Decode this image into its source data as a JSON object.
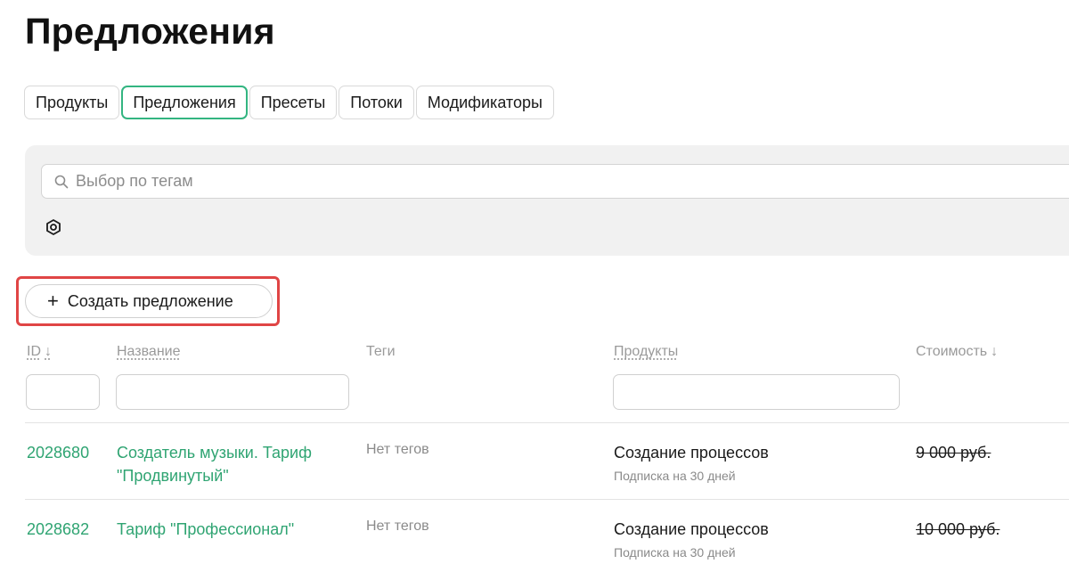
{
  "page": {
    "title": "Предложения"
  },
  "tabs": [
    {
      "label": "Продукты",
      "active": false
    },
    {
      "label": "Предложения",
      "active": true
    },
    {
      "label": "Пресеты",
      "active": false
    },
    {
      "label": "Потоки",
      "active": false
    },
    {
      "label": "Модификаторы",
      "active": false
    }
  ],
  "filters": {
    "tag_search_placeholder": "Выбор по тегам",
    "settings_icon": "hexagon-settings-icon"
  },
  "actions": {
    "create_label": "Создать предложение",
    "create_icon": "+"
  },
  "table": {
    "columns": [
      {
        "label": "ID",
        "sort": "↓"
      },
      {
        "label": "Название"
      },
      {
        "label": "Теги"
      },
      {
        "label": "Продукты"
      },
      {
        "label": "Стоимость",
        "sort": "↓"
      }
    ],
    "rows": [
      {
        "id": "2028680",
        "name": "Создатель музыки. Тариф \"Продвинутый\"",
        "tags": "Нет тегов",
        "product": "Создание процессов",
        "product_sub": "Подписка на 30 дней",
        "price_old": "9 000 руб."
      },
      {
        "id": "2028682",
        "name": "Тариф \"Профессионал\"",
        "tags": "Нет тегов",
        "product": "Создание процессов",
        "product_sub": "Подписка на 30 дней",
        "price_old": "10 000 руб."
      }
    ]
  },
  "colors": {
    "accent": "#2fa472",
    "highlight": "#e04545"
  }
}
